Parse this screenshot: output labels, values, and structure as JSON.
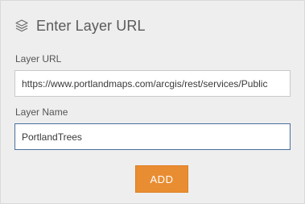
{
  "header": {
    "icon": "layers-icon",
    "title": "Enter Layer URL"
  },
  "layer_url": {
    "label": "Layer URL",
    "value": "https://www.portlandmaps.com/arcgis/rest/services/Public"
  },
  "layer_name": {
    "label": "Layer Name",
    "value": "PortlandTrees"
  },
  "add_button": {
    "label": "ADD"
  },
  "colors": {
    "panel_background": "#eeeeee",
    "add_button": "#e98d32",
    "focused_field_border": "#4a6e9c"
  }
}
